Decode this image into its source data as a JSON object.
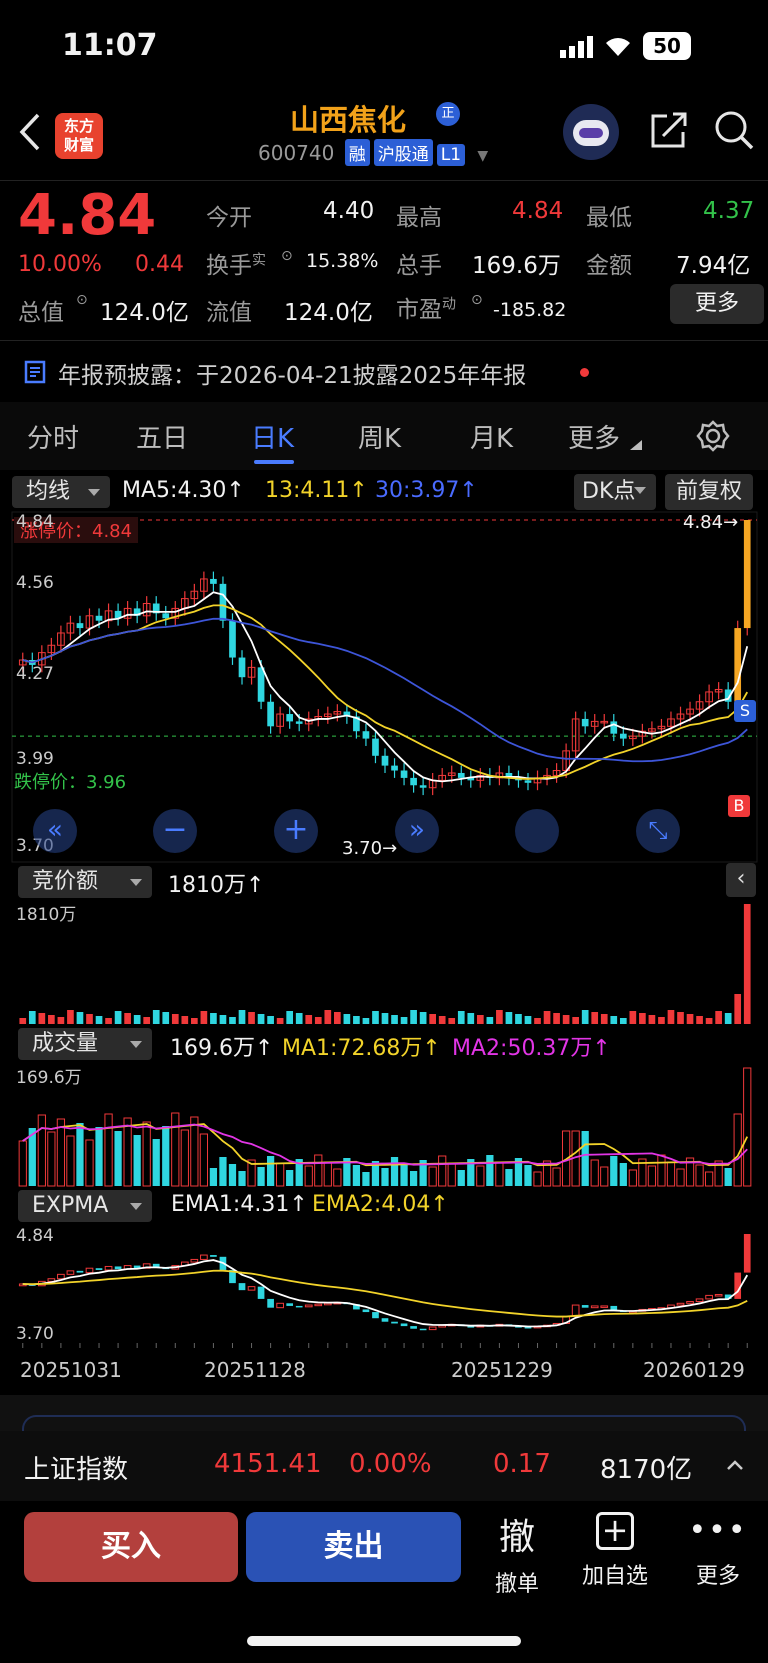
{
  "status_bar": {
    "time": "11:07",
    "battery": "50"
  },
  "header": {
    "logo_line1": "东方",
    "logo_line2": "财富",
    "stock_name": "山西焦化",
    "badge": "正",
    "code": "600740",
    "tags": [
      "融",
      "沪股通",
      "L1"
    ]
  },
  "quote": {
    "price": "4.84",
    "change_pct": "10.00%",
    "change": "0.44",
    "open_label": "今开",
    "open": "4.40",
    "high_label": "最高",
    "high": "4.84",
    "low_label": "最低",
    "low": "4.37",
    "turnover_label": "换手",
    "turnover_sup": "实",
    "turnover": "15.38%",
    "volume_label": "总手",
    "volume": "169.6万",
    "amount_label": "金额",
    "amount": "7.94亿",
    "mcap_label": "总值",
    "mcap": "124.0亿",
    "float_label": "流值",
    "float_mcap": "124.0亿",
    "pe_label": "市盈",
    "pe_sup": "动",
    "pe": "-185.82",
    "more_button": "更多"
  },
  "notice": {
    "text": "年报预披露：于2026-04-21披露2025年年报"
  },
  "tabs": [
    "分时",
    "五日",
    "日K",
    "周K",
    "月K",
    "更多"
  ],
  "active_tab": "日K",
  "kline": {
    "indicator": "均线",
    "ma5": "MA5:4.30↑",
    "ma13": "13:4.11↑",
    "ma30": "30:3.97↑",
    "dk_button": "DK点",
    "adjust_button": "前复权",
    "limit_up": "涨停价：4.84",
    "limit_down": "跌停价：3.96",
    "y_labels": [
      "4.84",
      "4.56",
      "4.27",
      "3.99",
      "3.70"
    ],
    "high_mark": "4.84→",
    "low_mark": "3.70→"
  },
  "auction": {
    "selector": "竞价额",
    "value": "1810万↑",
    "axis_max": "1810万"
  },
  "volume_panel": {
    "selector": "成交量",
    "value": "169.6万↑",
    "ma1": "MA1:72.68万↑",
    "ma2": "MA2:50.37万↑",
    "axis_max": "169.6万"
  },
  "expma": {
    "selector": "EXPMA",
    "ema1": "EMA1:4.31↑",
    "ema2": "EMA2:4.04↑",
    "axis_max": "4.84",
    "axis_min": "3.70"
  },
  "x_dates": [
    "20251031",
    "20251128",
    "20251229",
    "20260129"
  ],
  "index_bar": {
    "name": "上证指数",
    "value": "4151.41",
    "pct": "0.00%",
    "change": "0.17",
    "amount": "8170亿"
  },
  "bottom": {
    "buy": "买入",
    "sell": "卖出",
    "cancel_icon": "撤",
    "cancel": "撤单",
    "add": "加自选",
    "more": "更多"
  },
  "chart_data": {
    "type": "candlestick",
    "ylim": [
      3.7,
      4.84
    ],
    "closes": [
      4.27,
      4.25,
      4.3,
      4.33,
      4.38,
      4.42,
      4.4,
      4.45,
      4.43,
      4.47,
      4.44,
      4.48,
      4.45,
      4.5,
      4.46,
      4.44,
      4.48,
      4.52,
      4.55,
      4.6,
      4.58,
      4.43,
      4.28,
      4.2,
      4.24,
      4.1,
      4.0,
      4.05,
      4.02,
      4.01,
      4.03,
      4.04,
      4.05,
      4.06,
      4.04,
      3.98,
      3.95,
      3.88,
      3.84,
      3.82,
      3.79,
      3.76,
      3.75,
      3.78,
      3.8,
      3.81,
      3.79,
      3.78,
      3.8,
      3.79,
      3.81,
      3.79,
      3.78,
      3.77,
      3.79,
      3.8,
      3.82,
      3.9,
      4.03,
      4.0,
      4.02,
      4.02,
      3.97,
      3.95,
      3.96,
      3.98,
      3.99,
      4.0,
      4.03,
      4.05,
      4.07,
      4.1,
      4.14,
      4.15,
      4.1,
      4.4,
      4.84
    ]
  }
}
